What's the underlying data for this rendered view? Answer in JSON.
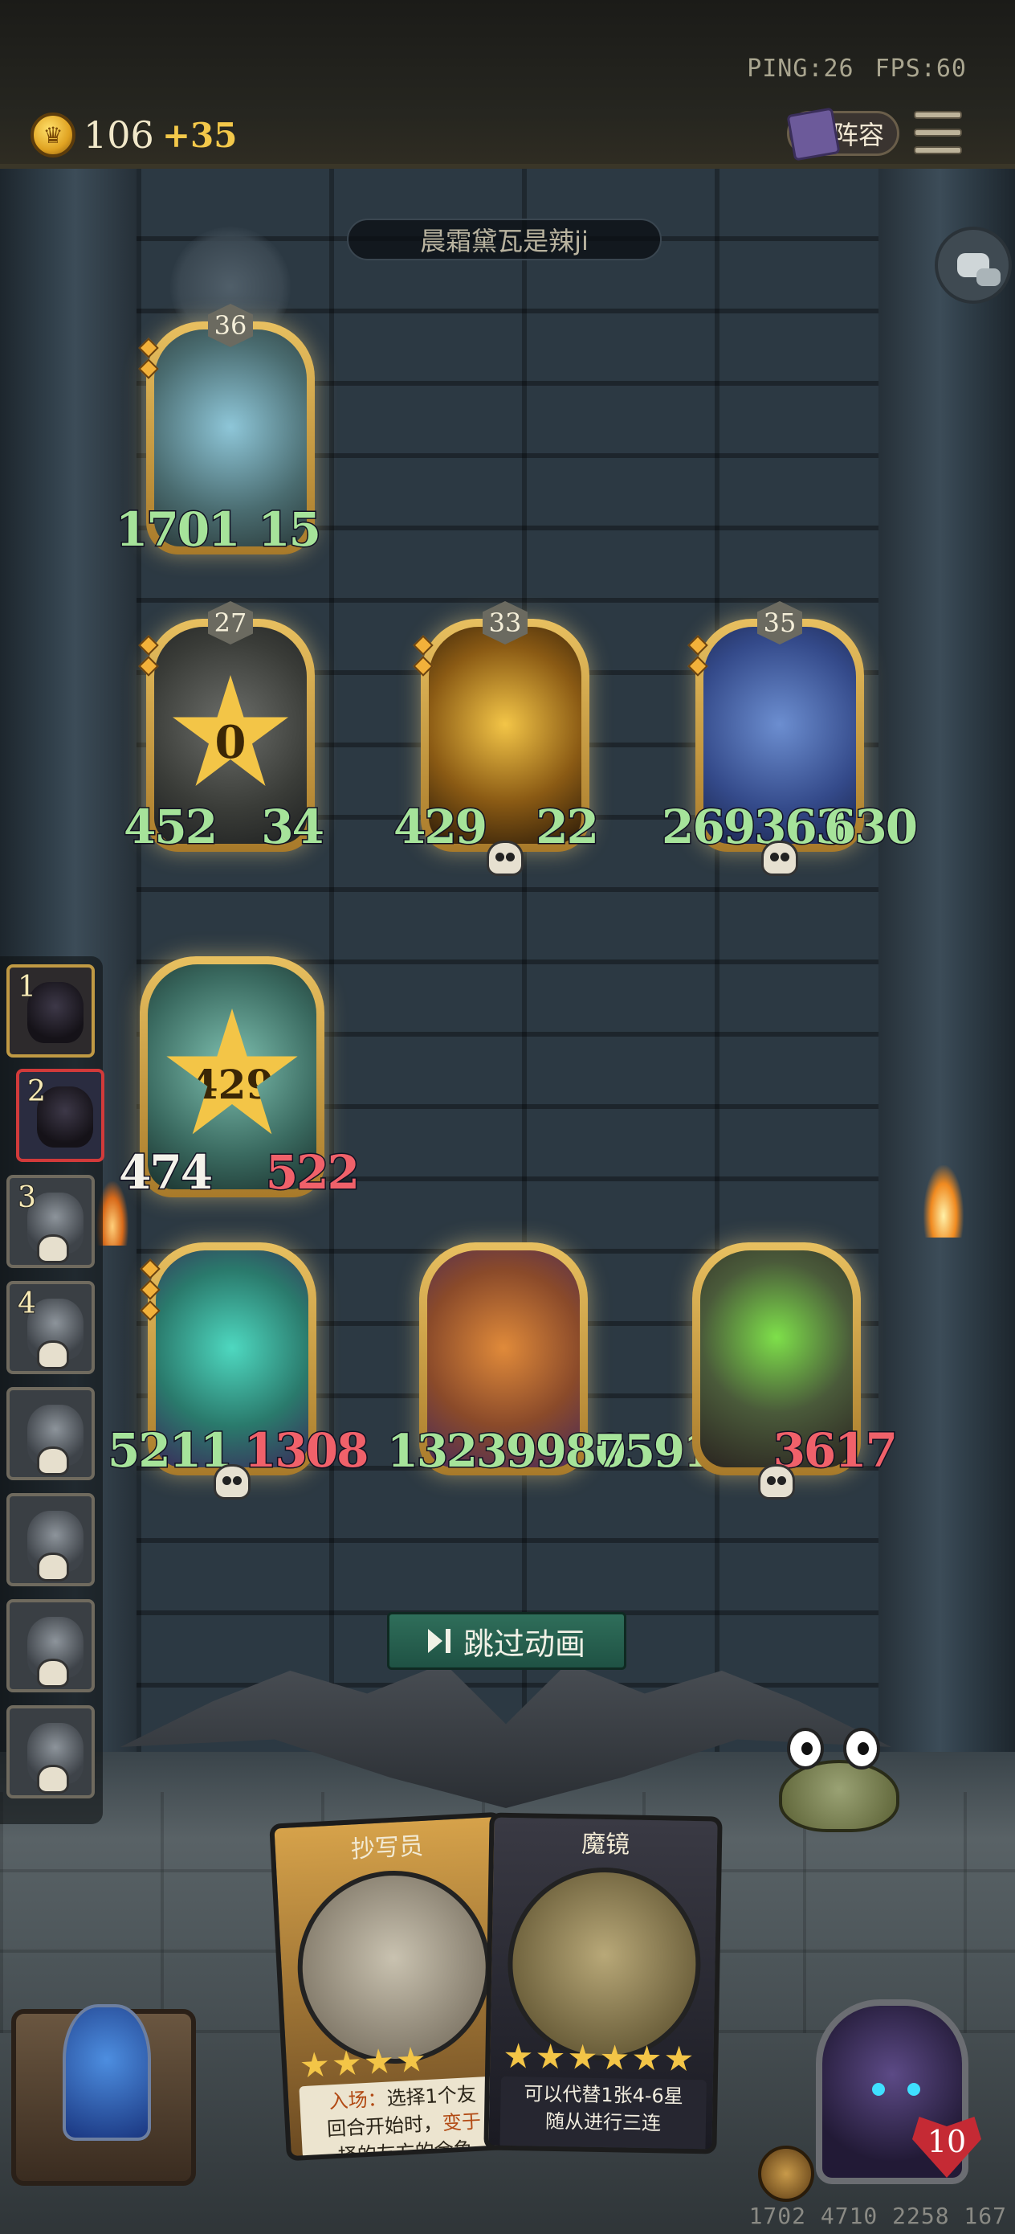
{
  "status": {
    "ping": "PING:26",
    "fps": "FPS:60"
  },
  "currency": {
    "gold": "106",
    "income": "+35"
  },
  "header": {
    "lineup_label": "阵容"
  },
  "opponent": {
    "name": "晨霜黛瓦是辣ji"
  },
  "opponent_board": [
    {
      "tier": "36",
      "attack": "1701",
      "health": "15",
      "attack_color": "green",
      "health_color": "green",
      "badge": ""
    },
    {
      "tier": "27",
      "attack": "452",
      "health": "34",
      "attack_color": "green",
      "health_color": "green",
      "badge": "0"
    },
    {
      "tier": "33",
      "attack": "429",
      "health": "22",
      "attack_color": "green",
      "health_color": "green",
      "badge": ""
    },
    {
      "tier": "35",
      "attack": "269363",
      "health": "630",
      "attack_color": "green",
      "health_color": "green",
      "badge": ""
    }
  ],
  "player_board": [
    {
      "attack": "474",
      "health": "522",
      "attack_color": "white",
      "health_color": "red",
      "badge": "429"
    },
    {
      "attack": "5211",
      "health": "1308",
      "attack_color": "green",
      "health_color": "red",
      "badge": ""
    },
    {
      "attack": "13239980",
      "health": "75910",
      "attack_color": "green",
      "health_color": "green",
      "badge": ""
    },
    {
      "attack": "",
      "health": "3617",
      "attack_color": "green",
      "health_color": "red",
      "badge": ""
    }
  ],
  "roster": [
    {
      "rank": "1"
    },
    {
      "rank": "2"
    },
    {
      "rank": "3"
    },
    {
      "rank": "4"
    },
    {
      "rank": ""
    },
    {
      "rank": ""
    },
    {
      "rank": ""
    },
    {
      "rank": ""
    }
  ],
  "skip_button": {
    "label": "跳过动画"
  },
  "hand": [
    {
      "name": "抄写员",
      "stars": 4,
      "desc_prefix": "入场：",
      "desc_line1": "选择1个友",
      "desc_line2": "回合开始时，",
      "desc_highlight": "变于",
      "desc_line3": "择的友方的余鱼"
    },
    {
      "name": "魔镜",
      "stars": 6,
      "desc_line1": "可以代替1张4-6星",
      "desc_line2": "随从进行三连"
    }
  ],
  "player_hero": {
    "health": "10"
  },
  "footer": {
    "id": "1702 4710 2258 167"
  }
}
